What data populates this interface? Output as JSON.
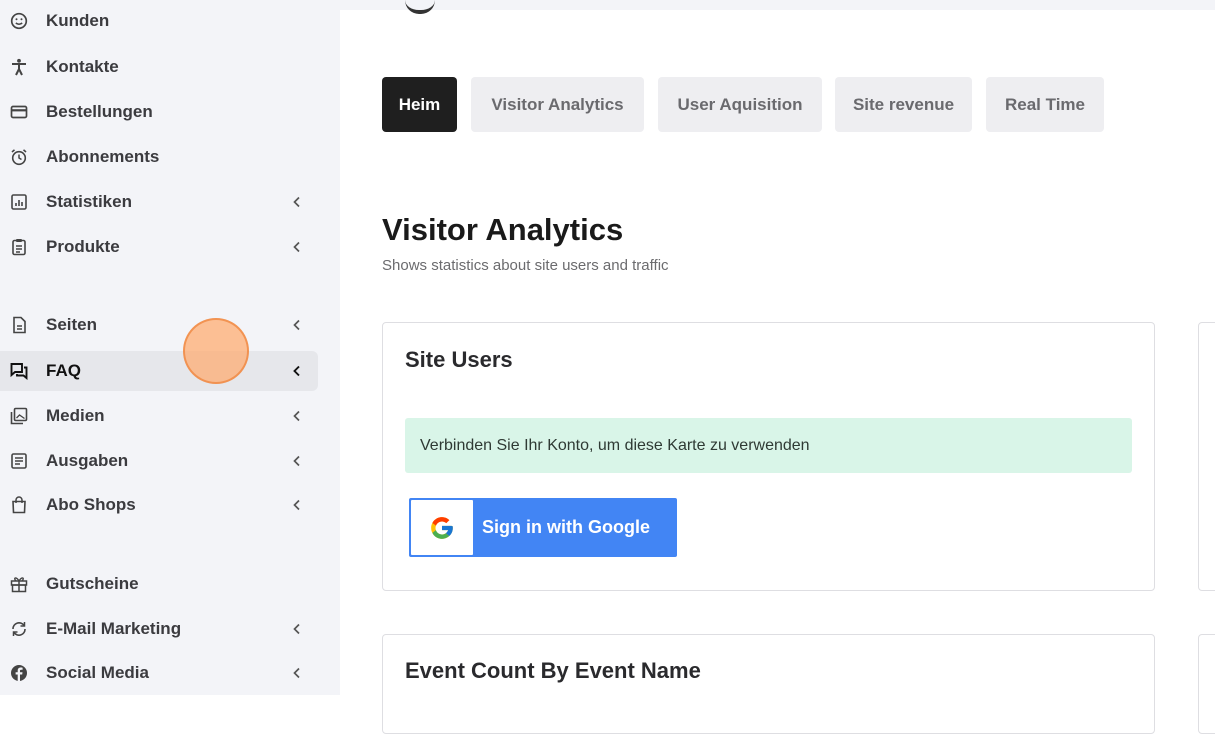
{
  "sidebar": {
    "items": [
      {
        "label": "Kunden",
        "icon": "smile-face-icon",
        "has_children": false,
        "active": false
      },
      {
        "label": "Kontakte",
        "icon": "person-accessibility-icon",
        "has_children": false,
        "active": false
      },
      {
        "label": "Bestellungen",
        "icon": "credit-card-icon",
        "has_children": false,
        "active": false
      },
      {
        "label": "Abonnements",
        "icon": "alarm-clock-icon",
        "has_children": false,
        "active": false
      },
      {
        "label": "Statistiken",
        "icon": "bar-chart-icon",
        "has_children": true,
        "active": false
      },
      {
        "label": "Produkte",
        "icon": "clipboard-icon",
        "has_children": true,
        "active": false
      },
      {
        "label": "Seiten",
        "icon": "document-icon",
        "has_children": true,
        "active": false
      },
      {
        "label": "FAQ",
        "icon": "chat-bubbles-icon",
        "has_children": true,
        "active": true
      },
      {
        "label": "Medien",
        "icon": "image-gallery-icon",
        "has_children": true,
        "active": false
      },
      {
        "label": "Ausgaben",
        "icon": "list-document-icon",
        "has_children": true,
        "active": false
      },
      {
        "label": "Abo Shops",
        "icon": "shopping-bag-icon",
        "has_children": true,
        "active": false
      },
      {
        "label": "Gutscheine",
        "icon": "gift-icon",
        "has_children": false,
        "active": false
      },
      {
        "label": "E-Mail Marketing",
        "icon": "refresh-arrows-icon",
        "has_children": true,
        "active": false
      },
      {
        "label": "Social Media",
        "icon": "facebook-icon",
        "has_children": true,
        "active": false
      }
    ]
  },
  "tabs": [
    {
      "label": "Heim",
      "active": true
    },
    {
      "label": "Visitor Analytics",
      "active": false
    },
    {
      "label": "User Aquisition",
      "active": false
    },
    {
      "label": "Site revenue",
      "active": false
    },
    {
      "label": "Real Time",
      "active": false
    }
  ],
  "page": {
    "title": "Visitor Analytics",
    "subtitle": "Shows statistics about site users and traffic"
  },
  "cards": {
    "site_users": {
      "title": "Site Users",
      "alert": "Verbinden Sie Ihr Konto, um diese Karte zu verwenden",
      "google_button": "Sign in with Google"
    },
    "event_count": {
      "title": "Event Count By Event Name"
    }
  },
  "colors": {
    "sidebar_bg": "#f3f4f8",
    "active_tab_bg": "#1f1f1f",
    "alert_bg": "#d9f5e8",
    "google_blue": "#4285f4"
  }
}
